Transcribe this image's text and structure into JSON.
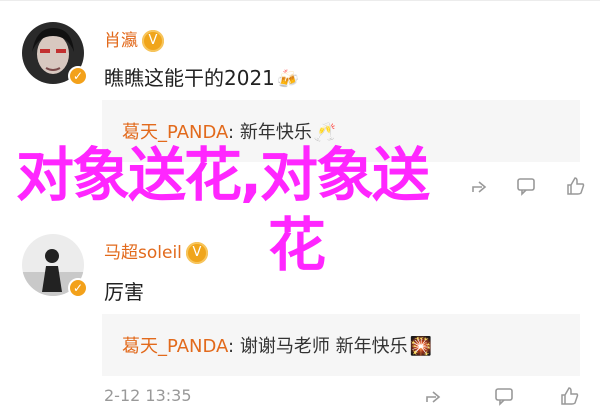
{
  "comments": [
    {
      "username": "肖瀛",
      "text": "瞧瞧这能干的2021",
      "emoji": "🍻",
      "reply": {
        "author": "葛天_PANDA",
        "sep": ":",
        "text": "新年快乐",
        "emoji": "🥂"
      }
    },
    {
      "username": "马超soleil",
      "text": "厉害",
      "reply": {
        "author": "葛天_PANDA",
        "sep": ":",
        "text": "谢谢马老师 新年快乐",
        "emoji": "🎇"
      },
      "timestamp": "2-12 13:35"
    }
  ],
  "overlay": {
    "line1": "对象送花,对象送",
    "line2": "花"
  },
  "icons": {
    "share": "share-icon",
    "comment": "comment-icon",
    "like": "like-icon",
    "verified": "verified-icon",
    "badge": "vip-badge-icon"
  },
  "colors": {
    "username": "#e26a1c",
    "overlay": "#ff26ff",
    "badge": "#f0a51b",
    "reply_bg": "#f6f6f6"
  }
}
